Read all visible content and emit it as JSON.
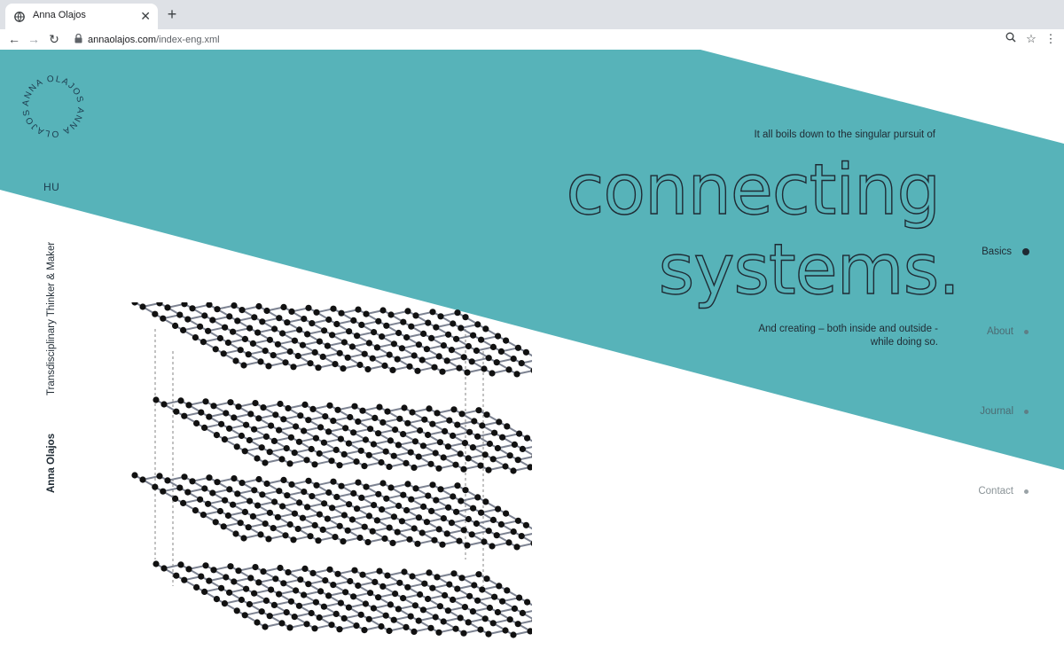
{
  "browser": {
    "tab_title": "Anna Olajos",
    "tab_close": "✕",
    "new_tab": "+",
    "url_host": "annaolajos.com",
    "url_path": "/index-eng.xml",
    "back": "←",
    "forward": "→",
    "reload": "↻",
    "zoom": "⚲",
    "bookmark": "☆",
    "menu": "⋮"
  },
  "site": {
    "logo_text": "ANNA OLAJOS ANNA OLAJOS ",
    "language_link": "HU",
    "tagline": "Transdisciplinary Thinker & Maker",
    "name": "Anna Olajos",
    "intro": "It all boils down to the singular pursuit of",
    "headline_line1": "connecting",
    "headline_line2": "systems.",
    "subtext_line1": "And creating – both inside and outside -",
    "subtext_line2": "while doing so."
  },
  "nav": {
    "items": [
      {
        "label": "Basics",
        "active": true
      },
      {
        "label": "About",
        "active": false
      },
      {
        "label": "Journal",
        "active": false
      },
      {
        "label": "Contact",
        "active": false
      }
    ]
  },
  "colors": {
    "teal": "#57b3b9",
    "dark": "#1f2a33",
    "accent_text": "#1d3c4f"
  }
}
